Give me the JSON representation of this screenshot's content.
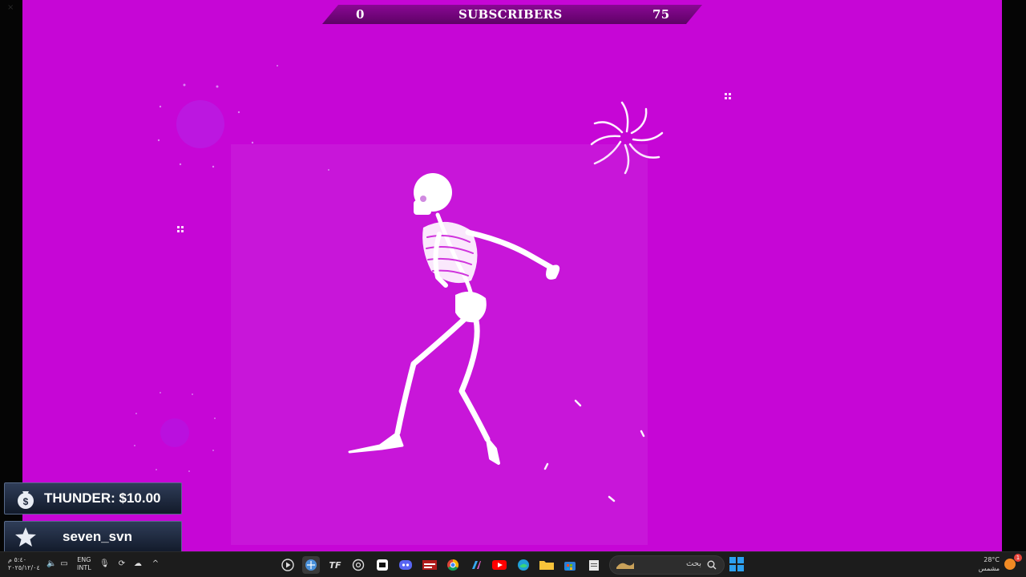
{
  "window": {
    "close_glyph": "×"
  },
  "subscriber_goal": {
    "min": "0",
    "label": "SUBSCRIBERS",
    "max": "75",
    "current_fraction": 0.0
  },
  "alerts": {
    "donation": {
      "text": "THUNDER: $10.00",
      "icon": "money-bag-icon"
    },
    "follow": {
      "text": "seven_svn",
      "icon": "star-icon"
    }
  },
  "taskbar": {
    "clock_time": "٥:٤٠ م",
    "clock_date": "٢٠٢٥/١٢/٠٤",
    "lang_line1": "ENG",
    "lang_line2": "INTL",
    "search_placeholder": "بحث",
    "weather_temp": "28°C",
    "weather_desc": "مشمس",
    "notification_count": "1",
    "apps": [
      "media-player",
      "browser-pinned",
      "tf-app",
      "chatgpt",
      "capcut",
      "discord",
      "twitch-app",
      "chrome",
      "copilot",
      "youtube",
      "edge",
      "file-explorer",
      "microsoft-store",
      "notepad"
    ]
  },
  "colors": {
    "stage_bg": "#c606d6",
    "bar_bg": "#7a0785",
    "alert_bg": "#1d273b"
  }
}
